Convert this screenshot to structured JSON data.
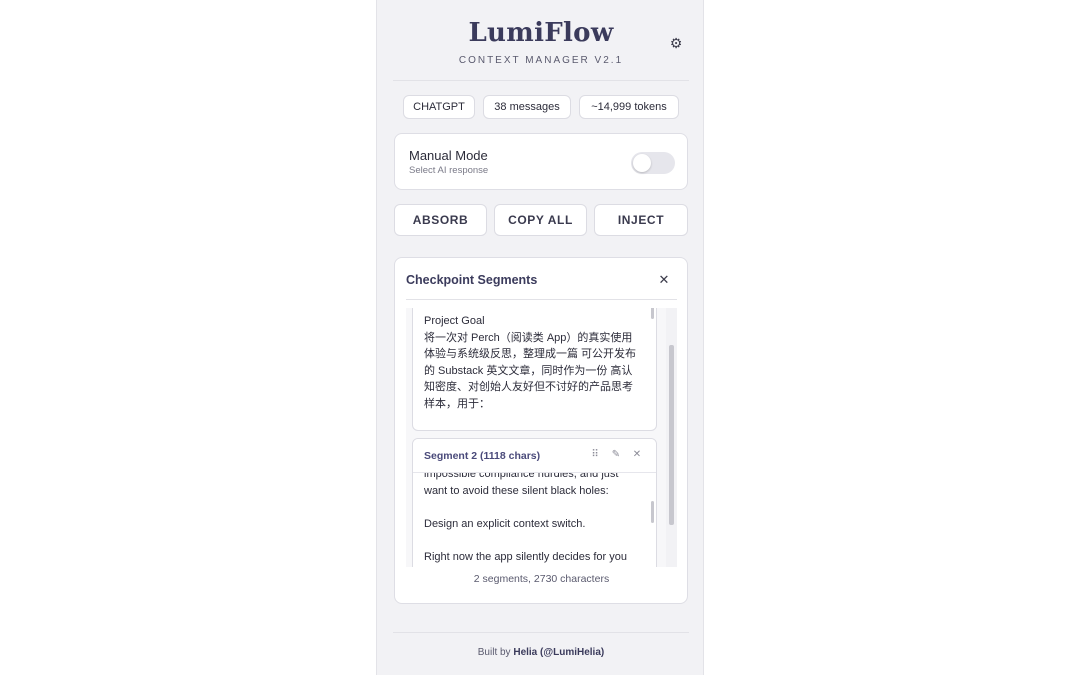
{
  "header": {
    "title": "LumiFlow",
    "subtitle": "CONTEXT MANAGER V2.1",
    "settings_icon": "gear-icon"
  },
  "stats": {
    "platform": "CHATGPT",
    "messages": "38 messages",
    "tokens": "~14,999 tokens"
  },
  "manual_mode": {
    "title": "Manual Mode",
    "subtitle": "Select AI response",
    "enabled": false
  },
  "actions": {
    "absorb": "ABSORB",
    "copy_all": "COPY ALL",
    "inject": "INJECT"
  },
  "segments_panel": {
    "title": "Checkpoint Segments",
    "close_icon": "close-icon",
    "segment1_text": "Project Goal\n将一次对 Perch（阅读类 App）的真实使用\n体验与系统级反思，整理成一篇 可公开发布\n的 Substack 英文文章，同时作为一份 高认\n知密度、对创始人友好但不讨好的产品思考\n样本，用于：",
    "segment2": {
      "label": "Segment 2 (1118 chars)",
      "drag_icon": "drag-handle-icon",
      "edit_icon": "pencil-icon",
      "delete_icon": "close-icon",
      "text": "impossible compliance hurdles, and just\nwant to avoid these silent black holes:\n\nDesign an explicit context switch.\n\nRight now the app silently decides for you"
    },
    "summary": "2 segments, 2730 characters"
  },
  "footer": {
    "prefix": "Built by",
    "author": "Helia (@LumiHelia)"
  },
  "colors": {
    "panel_bg": "#f2f2f5",
    "brand": "#3b3b5c",
    "segment_label": "#4a4a7a"
  }
}
